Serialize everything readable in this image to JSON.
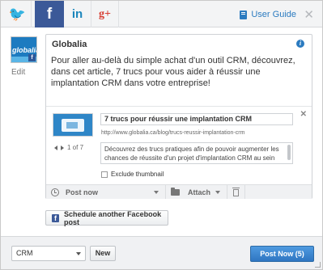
{
  "networks": [
    {
      "name": "Twitter",
      "glyph": "🐦",
      "icon": "twitter-icon"
    },
    {
      "name": "Facebook",
      "glyph": "f",
      "icon": "facebook-icon"
    },
    {
      "name": "LinkedIn",
      "glyph": "in",
      "icon": "linkedin-icon"
    },
    {
      "name": "Google+",
      "glyph": "g+",
      "icon": "google-plus-icon"
    }
  ],
  "header": {
    "user_guide": "User Guide",
    "close": "✕"
  },
  "profile": {
    "avatar_text": "globalia",
    "badge": "f",
    "edit": "Edit"
  },
  "composer": {
    "account_name": "Globalia",
    "info": "i",
    "message": "Pour aller au-delà du simple achat d'un outil CRM, découvrez, dans cet article, 7 trucs pour vous aider à réussir une implantation CRM dans votre entreprise!"
  },
  "preview": {
    "close": "✕",
    "title": "7 trucs pour réussir une implantation CRM",
    "url": "http://www.globalia.ca/blog/trucs-reussir-implantation-crm",
    "description": "Découvrez des trucs pratiques afin de pouvoir augmenter les chances de réussite d'un projet d'implantation CRM au sein de",
    "pager": "1 of 7",
    "exclude_thumbnail": "Exclude thumbnail"
  },
  "compose_bar": {
    "post_now": "Post now",
    "attach": "Attach"
  },
  "schedule_button": "Schedule another Facebook post",
  "footer": {
    "select_value": "CRM",
    "new_label": "New",
    "post_label": "Post Now (5)"
  },
  "colors": {
    "facebook": "#3b5998",
    "twitter": "#2aa9e0",
    "linkedin": "#1b86bc",
    "google_plus": "#d73d32",
    "accent": "#2b7bc0"
  }
}
